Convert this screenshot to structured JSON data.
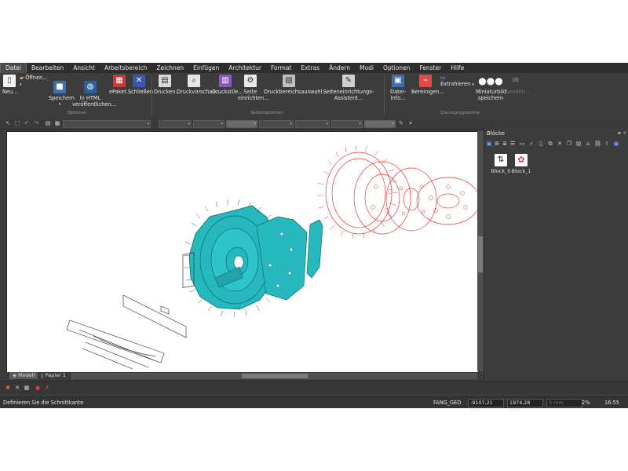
{
  "menu": [
    "Datei",
    "Bearbeiten",
    "Ansicht",
    "Arbeitsbereich",
    "Zeichnen",
    "Einfügen",
    "Architektur",
    "Format",
    "Extras",
    "Ändern",
    "Modi",
    "Optionen",
    "Fenster",
    "Hilfe"
  ],
  "ribbon": {
    "new": "Neu...",
    "open": "Öffnen...",
    "save": "Speichern",
    "html_line1": "In HTML",
    "html_line2": "veröffentlichen...",
    "epaket": "ePaket...",
    "close": "Schließen",
    "print": "Drucken...",
    "preview": "Druckvorschau...",
    "styles": "Druckstile...",
    "page_line1": "Seite",
    "page_line2": "einrichten...",
    "area": "Druckbereichsauswahl...",
    "wizard": "Seiteneinrichtungs-Assistent...",
    "info": "Datei-Info...",
    "clean": "Bereinigen...",
    "extract": "Extrahieren",
    "mini_line1": "Miniaturbild",
    "mini_line2": "speichern",
    "send": "Senden...",
    "group_options": "Optionen",
    "group_page": "Seitenoptionen",
    "group_services": "Dienstprogramme"
  },
  "blocks_panel": {
    "title": "Blöcke",
    "items": [
      "Block_0",
      "Block_1"
    ]
  },
  "tabs": [
    "Modell",
    "Papier 1"
  ],
  "status": {
    "prompt": "Definieren Sie die Schnittkante",
    "layer": "FANG_GEO",
    "x": "-9107,21 mm",
    "y": "1974,28 mm",
    "z": "0 mm",
    "zoom": "2%",
    "time": "16:55"
  },
  "colors": {
    "gear_cyan": "#27b8bd",
    "red_outline": "#e23a3a"
  }
}
